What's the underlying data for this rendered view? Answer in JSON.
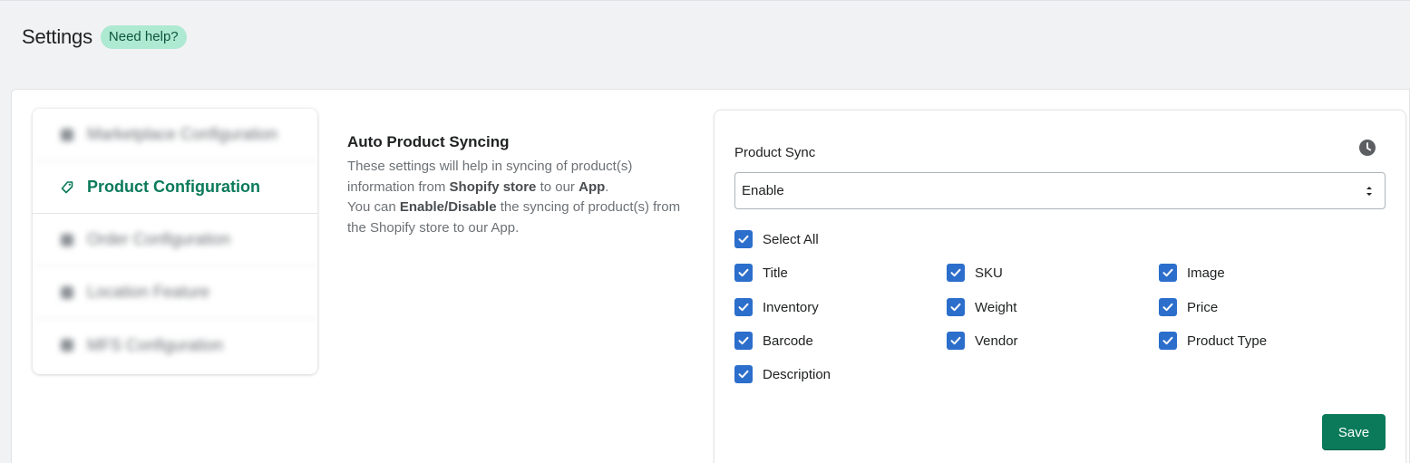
{
  "header": {
    "title": "Settings",
    "help_badge": "Need help?"
  },
  "sidebar": {
    "items": [
      {
        "label": "Marketplace Configuration",
        "blurred": true
      },
      {
        "label": "Product Configuration",
        "active": true
      },
      {
        "label": "Order Configuration",
        "blurred": true
      },
      {
        "label": "Location Feature",
        "blurred": true
      },
      {
        "label": "MFS Configuration",
        "blurred": true
      }
    ]
  },
  "section": {
    "title": "Auto Product Syncing",
    "line1_pre": "These settings will help in syncing of product(s) information from ",
    "line1_bold1": "Shopify store",
    "line1_mid": " to our ",
    "line1_bold2": "App",
    "line1_end": ".",
    "line2_pre": "You can ",
    "line2_bold": "Enable/Disable",
    "line2_post": " the syncing of product(s) from the Shopify store to our App."
  },
  "form": {
    "field_label": "Product Sync",
    "select_value": "Enable",
    "select_all_label": "Select All",
    "checkboxes": [
      {
        "label": "Title",
        "checked": true
      },
      {
        "label": "SKU",
        "checked": true
      },
      {
        "label": "Image",
        "checked": true
      },
      {
        "label": "Inventory",
        "checked": true
      },
      {
        "label": "Weight",
        "checked": true
      },
      {
        "label": "Price",
        "checked": true
      },
      {
        "label": "Barcode",
        "checked": true
      },
      {
        "label": "Vendor",
        "checked": true
      },
      {
        "label": "Product Type",
        "checked": true
      },
      {
        "label": "Description",
        "checked": true
      }
    ],
    "save_label": "Save"
  },
  "colors": {
    "accent": "#0a7a5a",
    "checkbox": "#2c6ecb",
    "badge_bg": "#aee9d1",
    "badge_text": "#0d5540"
  },
  "icons": {
    "nav_active": "tag-icon",
    "history": "clock-icon",
    "select": "select-arrows-icon",
    "check": "checkmark-icon"
  }
}
